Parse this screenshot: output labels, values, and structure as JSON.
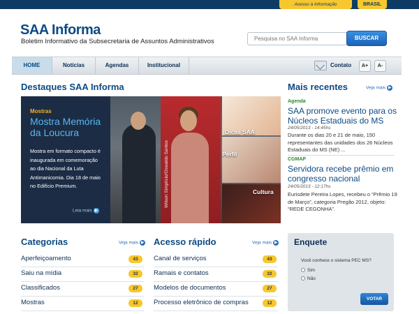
{
  "gov_bar": {
    "access_label": "Acesso à Informação",
    "brasil_label": "BRASIL"
  },
  "header": {
    "title": "SAA Informa",
    "subtitle": "Boletim Informativo da Subsecretaria de Assuntos Administrativos",
    "search_placeholder": "Pesquisa no SAA Informa",
    "search_button": "BUSCAR"
  },
  "nav": {
    "items": [
      "HOME",
      "Notícias",
      "Agendas",
      "Institucional"
    ],
    "active": "HOME",
    "contact_label": "Contato",
    "font_increase": "A+",
    "font_decrease": "A-"
  },
  "highlights": {
    "title": "Destaques SAA Informa",
    "kicker": "Mostras",
    "headline": "Mostra Memória da Loucura",
    "description": "Mostra em formato compacto é inaugurada em comemoração ao dia Nacional da Luta Antimanicomia. Dia 18 de maio no Edifício Premium.",
    "read_more": "Leia mais",
    "banner_text": "Wilson Simplício/Oswaldo Santos",
    "thumbs": [
      "Dicas SAA",
      "Perfil",
      "Cultura"
    ]
  },
  "recent": {
    "title": "Mais recentes",
    "see_more": "Veja mais",
    "items": [
      {
        "kicker": "Agenda",
        "title": "SAA promove evento para os Núcleos Estaduais do MS",
        "date": "24/05/2013 - 14:45hs",
        "body": "Durante os dias 20 e 21 de maio, 150 representantes das unidades dos 26 Núcleos Estaduais do MS (NE) ..."
      },
      {
        "kicker": "CGMAP",
        "title": "Servidora recebe prêmio em congresso nacional",
        "date": "24/05/2013 - 12:17hs",
        "body": "Eurisdete Pereira Lopes, recebeu o “Prêmio 19 de Março”, categoria Pregão 2012, objeto: “REDE CEGONHA”."
      }
    ]
  },
  "categories": {
    "title": "Categorias",
    "see_more": "Veja mais",
    "items": [
      {
        "label": "Aperfeiçoamento",
        "count": "43"
      },
      {
        "label": "Saiu na mídia",
        "count": "32"
      },
      {
        "label": "Classificados",
        "count": "27"
      },
      {
        "label": "Mostras",
        "count": "12"
      }
    ]
  },
  "quick_access": {
    "title": "Acesso rápido",
    "see_more": "Veja mais",
    "items": [
      {
        "label": "Canal de serviços",
        "count": "43"
      },
      {
        "label": "Ramais e contatos",
        "count": "32"
      },
      {
        "label": "Modelos de documentos",
        "count": "27"
      },
      {
        "label": "Processo eletrônico de compras",
        "count": "12"
      }
    ]
  },
  "poll": {
    "title": "Enquete",
    "question": "Você conhece o sistema PEC MS?",
    "options": [
      "Sim",
      "Não"
    ],
    "vote_button": "VOTAR"
  }
}
